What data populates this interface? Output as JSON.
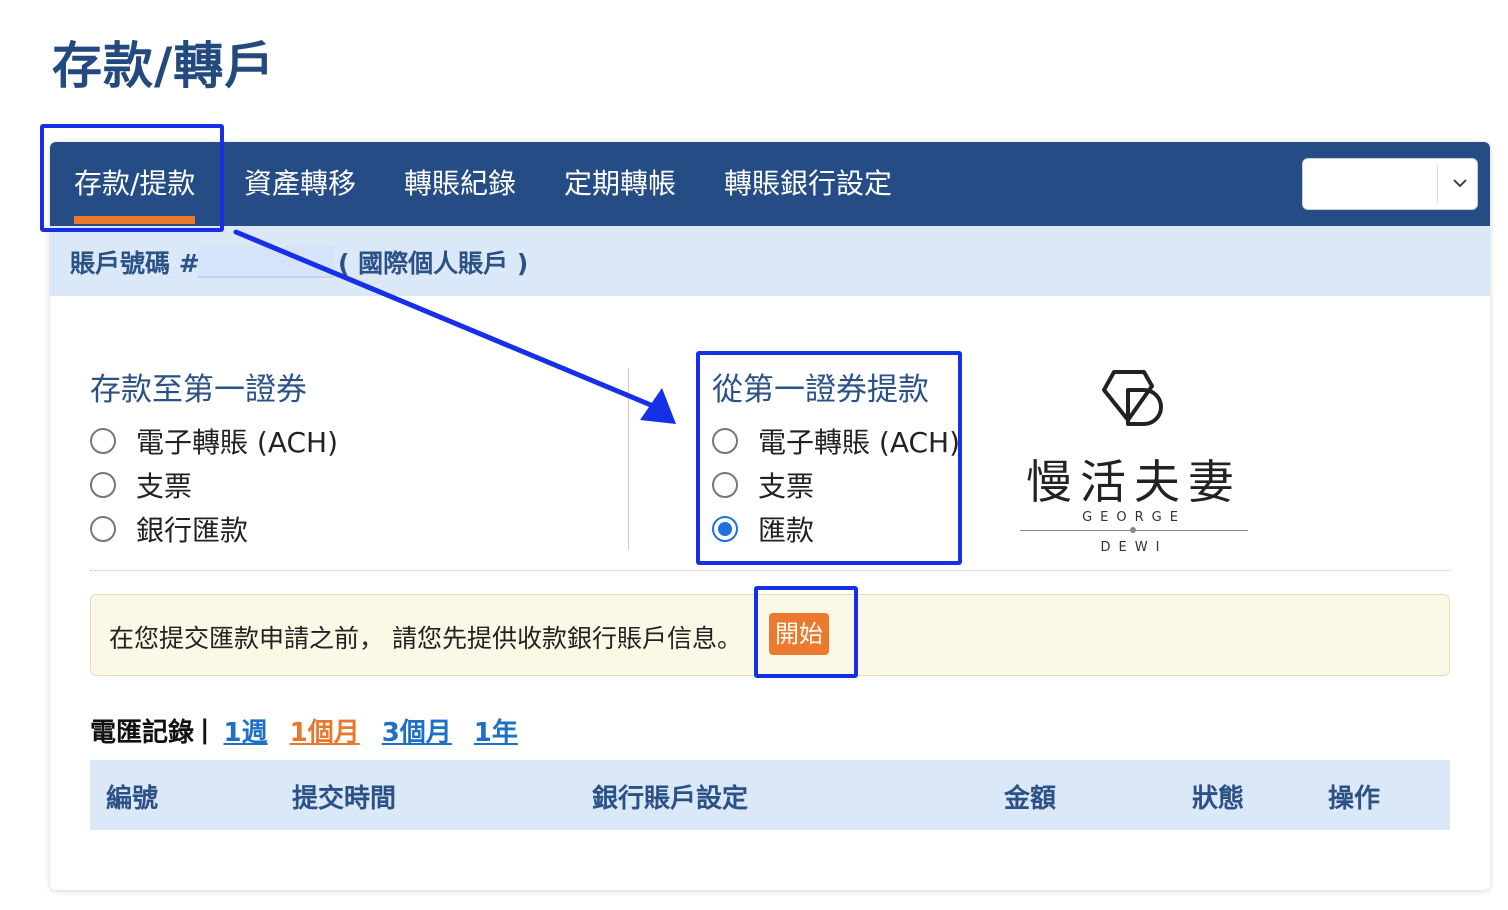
{
  "page": {
    "title": "存款/轉戶"
  },
  "nav": {
    "tabs": [
      {
        "label": "存款/提款",
        "active": true
      },
      {
        "label": "資產轉移"
      },
      {
        "label": "轉賬紀錄"
      },
      {
        "label": "定期轉帳"
      },
      {
        "label": "轉賬銀行設定"
      }
    ],
    "account_select": {
      "value": "",
      "icon": "chevron-down-icon"
    }
  },
  "account": {
    "label": "賬戶號碼 #",
    "number": "",
    "type": "( 國際個人賬戶 )"
  },
  "deposit": {
    "title": "存款至第一證券",
    "options": [
      {
        "label": "電子轉賬 (ACH)",
        "checked": false
      },
      {
        "label": "支票",
        "checked": false
      },
      {
        "label": "銀行匯款",
        "checked": false
      }
    ]
  },
  "withdraw": {
    "title": "從第一證券提款",
    "options": [
      {
        "label": "電子轉賬 (ACH)",
        "checked": false
      },
      {
        "label": "支票",
        "checked": false
      },
      {
        "label": "匯款",
        "checked": true
      }
    ]
  },
  "brand": {
    "name": "慢活夫妻",
    "sub1": "GEORGE",
    "sub2": "DEWI"
  },
  "notice": {
    "text": "在您提交匯款申請之前， 請您先提供收款銀行賬戶信息。",
    "button": "開始"
  },
  "history": {
    "label": "電匯記錄",
    "separator": "|",
    "periods": [
      {
        "label": "1週",
        "selected": false
      },
      {
        "label": "1個月",
        "selected": true
      },
      {
        "label": "3個月",
        "selected": false
      },
      {
        "label": "1年",
        "selected": false
      }
    ]
  },
  "table": {
    "columns": [
      "編號",
      "提交時間",
      "銀行賬戶設定",
      "金額",
      "狀態",
      "操作"
    ],
    "rows": []
  },
  "colors": {
    "nav_bg": "#254c84",
    "active_underline": "#ec7a2e",
    "header_band": "#dbe8f7",
    "title_blue": "#23497e",
    "link_blue": "#1d6fc7",
    "link_selected": "#e8792c",
    "radio_checked": "#1f6fe5",
    "annotation": "#1530e6"
  }
}
